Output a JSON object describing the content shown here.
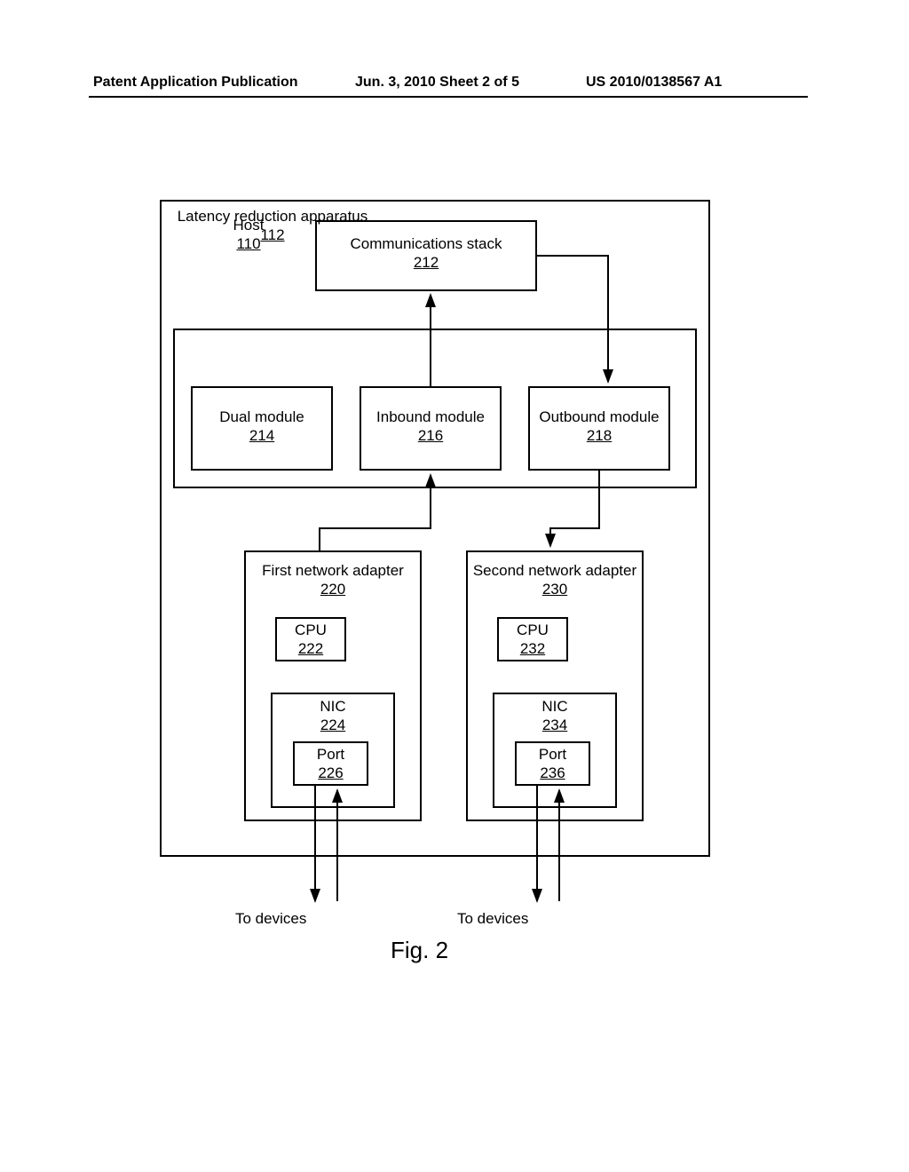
{
  "header": {
    "left": "Patent Application Publication",
    "center": "Jun. 3, 2010  Sheet 2 of 5",
    "right": "US 2010/0138567 A1"
  },
  "host": {
    "title": "Host",
    "ref": "110"
  },
  "comm_stack": {
    "title": "Communications stack",
    "ref": "212"
  },
  "apparatus": {
    "title": "Latency reduction apparatus",
    "ref": "112"
  },
  "dual": {
    "title": "Dual module",
    "ref": "214"
  },
  "inbound": {
    "title": "Inbound module",
    "ref": "216"
  },
  "outbound": {
    "title": "Outbound module",
    "ref": "218"
  },
  "adapter1": {
    "title": "First network adapter",
    "ref": "220"
  },
  "adapter2": {
    "title": "Second network adapter",
    "ref": "230"
  },
  "cpu1": {
    "title": "CPU",
    "ref": "222"
  },
  "cpu2": {
    "title": "CPU",
    "ref": "232"
  },
  "nic1": {
    "title": "NIC",
    "ref": "224"
  },
  "nic2": {
    "title": "NIC",
    "ref": "234"
  },
  "port1": {
    "title": "Port",
    "ref": "226"
  },
  "port2": {
    "title": "Port",
    "ref": "236"
  },
  "to_devices1": "To devices",
  "to_devices2": "To devices",
  "figure_caption": "Fig. 2"
}
